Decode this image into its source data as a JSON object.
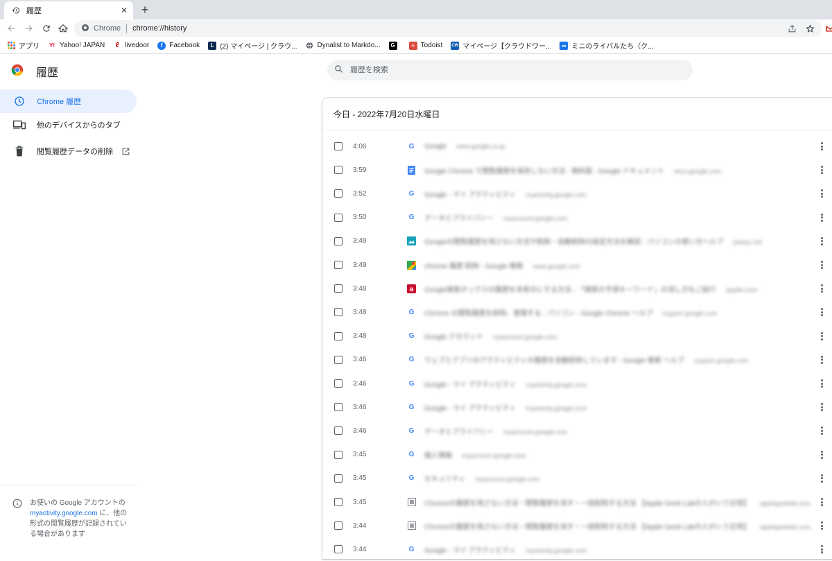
{
  "browser": {
    "tab_title": "履歴",
    "omnibox_site": "Chrome",
    "omnibox_url": "chrome://history",
    "bookmarks": [
      {
        "label": "アプリ",
        "icon": "apps-grid-icon",
        "color": "#4285f4"
      },
      {
        "label": "Yahoo! JAPAN",
        "icon": "yahoo-icon",
        "color": "#ff0033"
      },
      {
        "label": "livedoor",
        "icon": "livedoor-icon",
        "color": "#cc0000"
      },
      {
        "label": "Facebook",
        "icon": "facebook-icon",
        "color": "#1877f2"
      },
      {
        "label": "(2) マイページ | クラウ...",
        "icon": "lancers-icon",
        "color": "#0b2c4f"
      },
      {
        "label": "Dynalist to Markdo...",
        "icon": "globe-icon",
        "color": "#5f6368"
      },
      {
        "label": "",
        "icon": "g-dark-icon",
        "color": "#000000"
      },
      {
        "label": "Todoist",
        "icon": "todoist-icon",
        "color": "#db4c3f"
      },
      {
        "label": "マイページ【クラウドワー...",
        "icon": "crowdworks-icon",
        "color": "#0d5eb3"
      },
      {
        "label": "ミニのライバルたち（ク...",
        "icon": "infinity-icon",
        "color": "#1a73e8"
      }
    ]
  },
  "history": {
    "page_title": "履歴",
    "search_placeholder": "履歴を検索",
    "sidebar": {
      "chrome_history": "Chrome 履歴",
      "other_devices": "他のデバイスからのタブ",
      "clear_data": "閲覧履歴データの削除"
    },
    "footer": {
      "text_before": "お使いの Google アカウントの",
      "link": "myactivity.google.com",
      "text_after": "に、他の形式の閲覧履歴が記録されている場合があります"
    },
    "day_header": "今日 - 2022年7月20日水曜日",
    "entries": [
      {
        "time": "4:06",
        "icon": "google-icon",
        "title": "Google",
        "domain": "www.google.co.jp"
      },
      {
        "time": "3:59",
        "icon": "docs-icon",
        "title": "Google Chrome で閲覧履歴を保存しない方法 - 無料版 - Google ドキュメント",
        "domain": "docs.google.com"
      },
      {
        "time": "3:52",
        "icon": "google-icon",
        "title": "Google - マイ アクティビティ",
        "domain": "myactivity.google.com"
      },
      {
        "time": "3:50",
        "icon": "google-icon",
        "title": "データとプライバシー",
        "domain": "myaccount.google.com"
      },
      {
        "time": "3:49",
        "icon": "photo-icon",
        "title": "Googleの閲覧履歴を残さない方法や削除・自動削除の設定方法を解説 - パソコンの使い方ヘルプ",
        "domain": "pasoju.net"
      },
      {
        "time": "3:49",
        "icon": "maps-icon",
        "title": "chrome 履歴 削除 - Google 検索",
        "domain": "www.google.com"
      },
      {
        "time": "3:48",
        "icon": "a-icon",
        "title": "Google検索ボックスの履歴を非表示にする方法 - 「検索の予測キーワード」の消し方もご紹介",
        "domain": "appllio.com"
      },
      {
        "time": "3:48",
        "icon": "google-icon",
        "title": "Chrome の閲覧履歴を削除、管理する - パソコン - Google Chrome ヘルプ",
        "domain": "support.google.com"
      },
      {
        "time": "3:48",
        "icon": "google-icon",
        "title": "Google アカウント",
        "domain": "myaccount.google.com"
      },
      {
        "time": "3:46",
        "icon": "google-icon",
        "title": "ウェブとアプリのアクティビティの履歴を自動削除しています - Google 検索 ヘルプ",
        "domain": "support.google.com"
      },
      {
        "time": "3:46",
        "icon": "google-icon",
        "title": "Google - マイ アクティビティ",
        "domain": "myactivity.google.com"
      },
      {
        "time": "3:46",
        "icon": "google-icon",
        "title": "Google - マイ アクティビティ",
        "domain": "myactivity.google.com"
      },
      {
        "time": "3:46",
        "icon": "google-icon",
        "title": "データとプライバシー",
        "domain": "myaccount.google.com"
      },
      {
        "time": "3:45",
        "icon": "google-icon",
        "title": "個人情報",
        "domain": "myaccount.google.com"
      },
      {
        "time": "3:45",
        "icon": "google-icon",
        "title": "セキュリティ",
        "domain": "myaccount.google.com"
      },
      {
        "time": "3:45",
        "icon": "site-icon",
        "title": "Chromeの履歴を残さない方法・閲覧履歴を消す・一括削除する方法 【Apple Geek Labの人がいう日常】",
        "domain": "applegeeklab.com"
      },
      {
        "time": "3:44",
        "icon": "site-icon",
        "title": "Chromeの履歴を残さない方法・閲覧履歴を消す・一括削除する方法 【Apple Geek Labの人がいう日常】",
        "domain": "applegeeklab.com"
      },
      {
        "time": "3:44",
        "icon": "google-icon",
        "title": "Google - マイ アクティビティ",
        "domain": "myactivity.google.com"
      }
    ]
  },
  "colors": {
    "accent": "#1a73e8",
    "active_bg": "#e8f0fe",
    "search_bg": "#f1f3f4"
  }
}
